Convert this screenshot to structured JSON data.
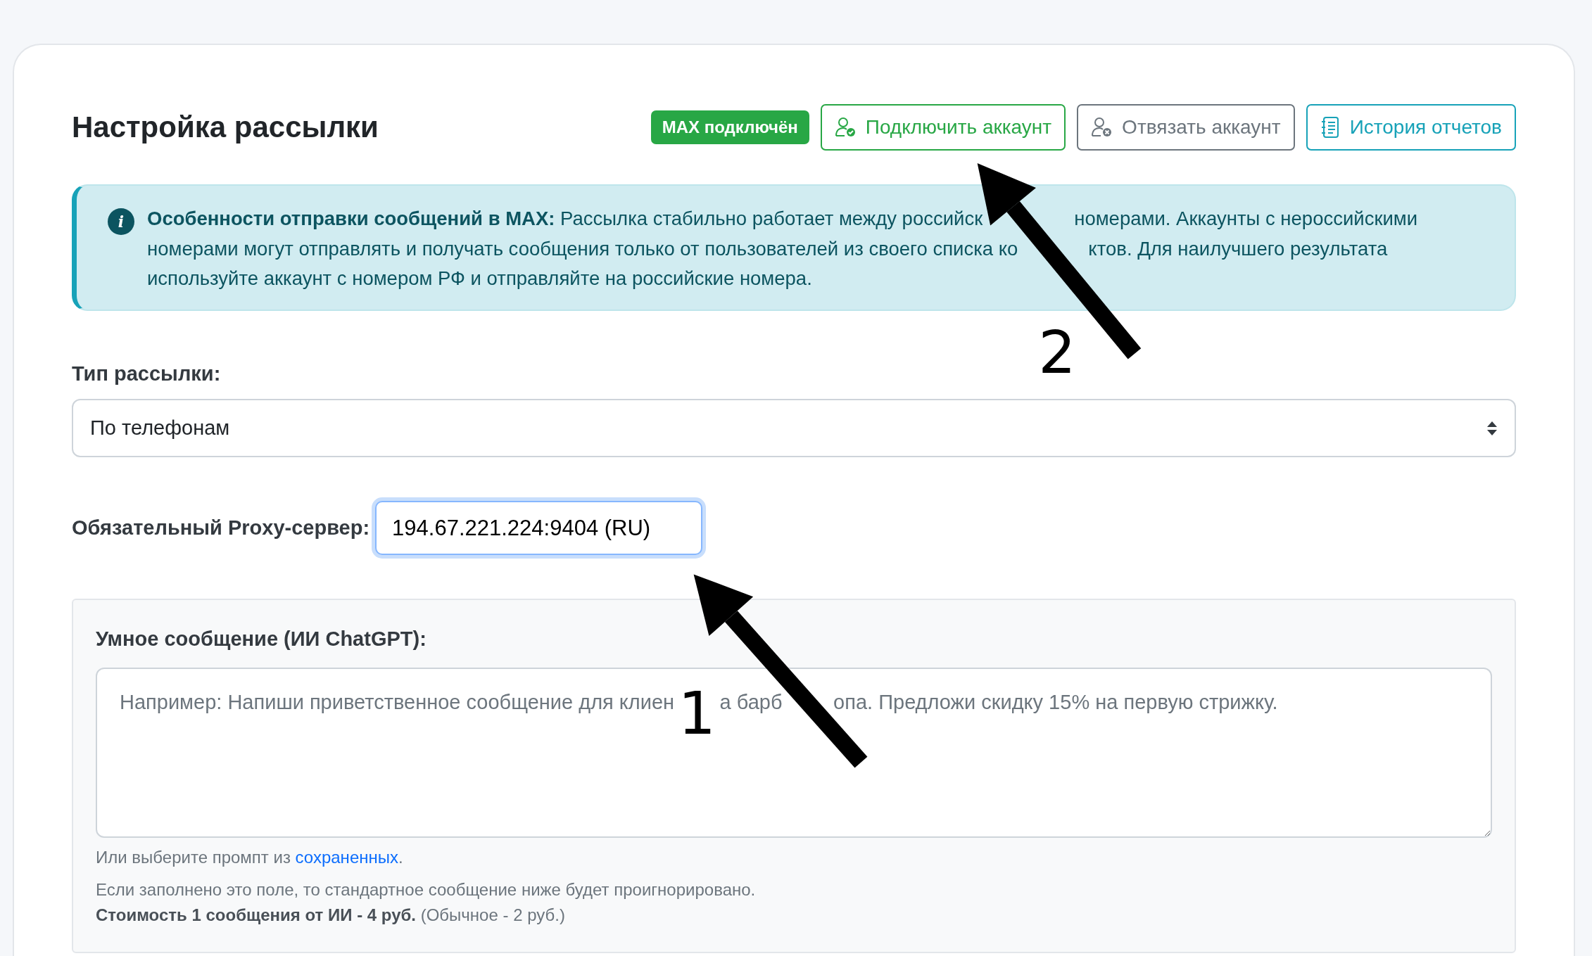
{
  "title": "Настройка рассылки",
  "status_badge": "MAX подключён",
  "header_buttons": [
    {
      "kind": "connect",
      "label": "Подключить аккаунт"
    },
    {
      "kind": "unbind",
      "label": "Отвязать аккаунт"
    },
    {
      "kind": "history",
      "label": "История отчетов"
    }
  ],
  "alert": {
    "icon": "i",
    "lines": [
      [
        "**Особенности отправки сообщений в MAX:** Рассылка стабильно работает между российск",
        "номерами. Аккаунты с нероссийскими"
      ],
      [
        "номерами могут отправлять и получать сообщения только от пользователей из своего списка ко",
        "ктов. Для наилучшего результата"
      ],
      [
        "используйте аккаунт с номером РФ и отправляйте на российские номера."
      ]
    ]
  },
  "mailing_type": {
    "label": "Тип рассылки:",
    "value": "По телефонам"
  },
  "proxy": {
    "label": "Обязательный Proxy-сервер:",
    "value": "194.67.221.224:9404 (RU)",
    "focused": true
  },
  "smart_message": {
    "label": "Умное сообщение (ИИ ChatGPT):",
    "placeholder": [
      "Например: Напиши приветственное сообщение для клиен",
      "а барб",
      "опа. Предложи скидку 15% на первую стрижку."
    ],
    "prompt_text": "Или выберите промпт из",
    "prompt_link": "сохраненных",
    "prompt_end": ".",
    "note": "Если заполнено это поле, то стандартное сообщение ниже будет проигнорировано.",
    "cost": "**Стоимость 1 сообщения от ИИ - 4 руб.** (Обычное - 2 руб.)"
  },
  "annotations": [
    {
      "label": "1",
      "kind": "arrow"
    },
    {
      "label": "2",
      "kind": "arrow"
    }
  ]
}
